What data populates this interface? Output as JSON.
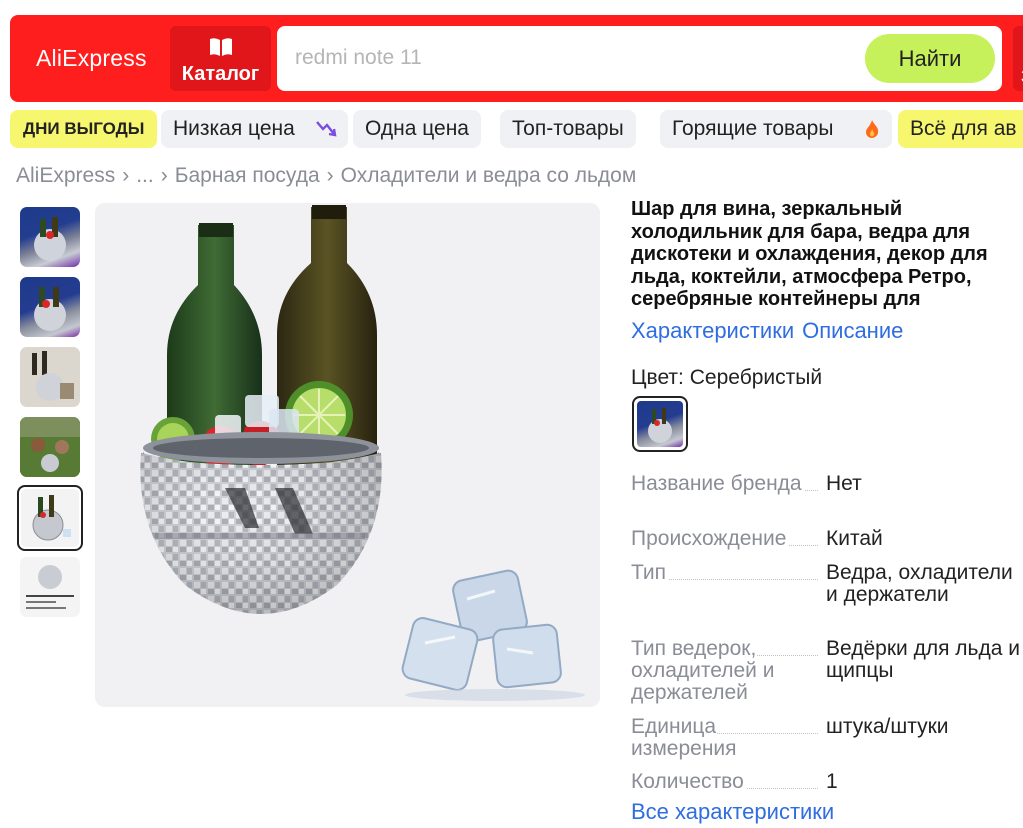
{
  "header": {
    "logo": "AliExpress",
    "catalog_label": "Каталог",
    "search_placeholder": "redmi note 11",
    "search_button": "Найти",
    "right_partial": "З"
  },
  "chips": [
    {
      "label": "ДНИ ВЫГОДЫ",
      "style": "promo"
    },
    {
      "label": "Низкая цена",
      "icon": "trend-down-icon"
    },
    {
      "label": "Одна цена"
    },
    {
      "label": "Топ-товары"
    },
    {
      "label": "Горящие товары",
      "icon": "fire-icon"
    },
    {
      "label": "Всё для ав",
      "style": "yellow"
    }
  ],
  "breadcrumbs": [
    "AliExpress",
    "...",
    "Барная посуда",
    "Охладители и ведра со льдом"
  ],
  "product": {
    "title": "Шар для вина, зеркальный холодильник для бара, ведра для дискотеки и охлаждения, декор для льда, коктейли, атмосфера Ретро, серебряные контейнеры для",
    "anchor_specs": "Характеристики",
    "anchor_description": "Описание",
    "color_label": "Цвет: Серебристый",
    "specs": [
      {
        "key": "Название бренда",
        "value": "Нет"
      },
      {
        "key": "Происхождение",
        "value": "Китай"
      },
      {
        "key": "Тип",
        "value": "Ведра, охладители и держатели"
      },
      {
        "key": "Тип ведерок, охладителей и держателей",
        "value": "Ведёрки для льда и щипцы"
      },
      {
        "key": "Единица измерения",
        "value": "штука/штуки"
      },
      {
        "key": "Количество",
        "value": "1"
      }
    ],
    "all_specs_link": "Все характеристики"
  },
  "colors": {
    "header_red": "#ff1e1e",
    "search_button_green": "#c6f15b",
    "promo_yellow": "#f6f76f",
    "link_blue": "#2f6de1"
  }
}
